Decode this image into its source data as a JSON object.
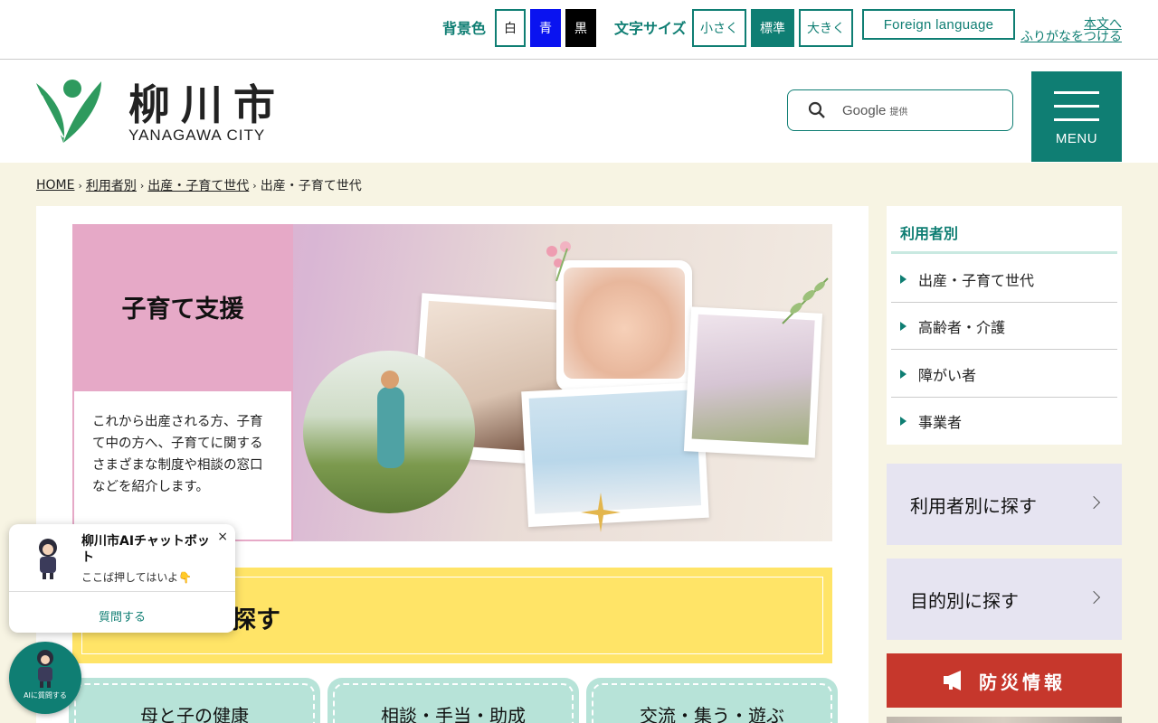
{
  "utility": {
    "bg_label": "背景色",
    "bg_white": "白",
    "bg_blue": "青",
    "bg_black": "黒",
    "size_label": "文字サイズ",
    "size_small": "小さく",
    "size_standard": "標準",
    "size_large": "大きく",
    "foreign": "Foreign language",
    "skip_main": "本文へ",
    "furigana": "ふりがなをつける"
  },
  "header": {
    "logo_jp": "柳川市",
    "logo_en": "YANAGAWA CITY",
    "search_brand": "Google",
    "search_brand_suffix": "提供",
    "menu_label": "MENU"
  },
  "breadcrumb": {
    "home": "HOME",
    "level1": "利用者別",
    "level2": "出産・子育て世代",
    "current": "出産・子育て世代"
  },
  "hero": {
    "title": "子育て支援",
    "description": "これから出産される方、子育て中の方へ、子育てに関するさまざまな制度や相談の窓口などを紹介します。"
  },
  "search_section": {
    "title": "探す"
  },
  "categories": [
    {
      "label": "母と子の健康"
    },
    {
      "label": "相談・手当・助成"
    },
    {
      "label": "交流・集う・遊ぶ"
    }
  ],
  "sidebar": {
    "heading": "利用者別",
    "items": [
      {
        "label": "出産・子育て世代"
      },
      {
        "label": "高齢者・介護"
      },
      {
        "label": "障がい者"
      },
      {
        "label": "事業者"
      }
    ],
    "by_user": "利用者別に探す",
    "by_purpose": "目的別に探す",
    "disaster": "防災情報"
  },
  "chatbot": {
    "title": "柳川市AIチャットボット",
    "subtitle": "ここば押してはいよ👇",
    "ask": "質問する",
    "fab_label": "AIに質問する",
    "close": "×"
  },
  "colors": {
    "brand_green": "#0f7e73",
    "hero_pink": "#e6a9c7",
    "search_yellow": "#ffe467",
    "category_mint": "#b7e3d8",
    "disaster_red": "#c6372c",
    "page_cream": "#f7f4e3"
  }
}
